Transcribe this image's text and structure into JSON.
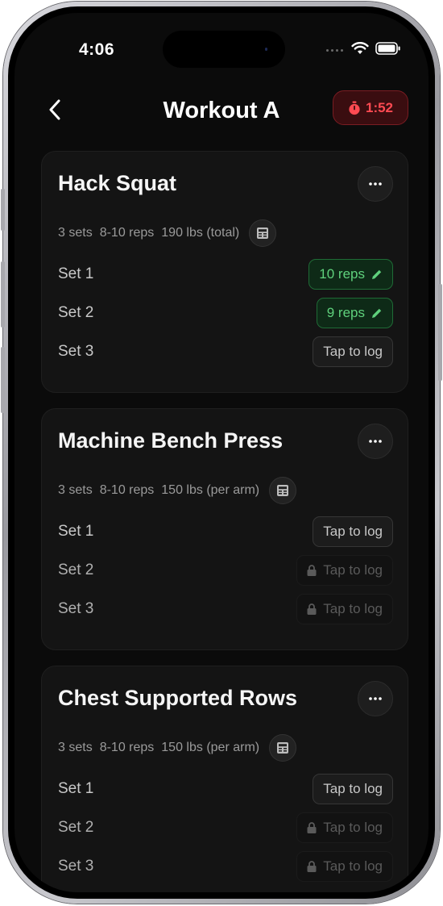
{
  "status": {
    "time": "4:06"
  },
  "header": {
    "title": "Workout A",
    "timer": "1:52"
  },
  "colors": {
    "accent_green": "#5fd17c",
    "timer_red": "#ff4a52",
    "background": "#0b0b0b"
  },
  "exercises": [
    {
      "name": "Hack Squat",
      "sets_text": "3 sets",
      "reps_text": "8-10 reps",
      "weight_text": "190 lbs (total)",
      "sets": [
        {
          "label": "Set 1",
          "status": "done",
          "text": "10 reps"
        },
        {
          "label": "Set 2",
          "status": "done",
          "text": "9 reps"
        },
        {
          "label": "Set 3",
          "status": "tap",
          "text": "Tap to log"
        }
      ]
    },
    {
      "name": "Machine Bench Press",
      "sets_text": "3 sets",
      "reps_text": "8-10 reps",
      "weight_text": "150 lbs (per arm)",
      "sets": [
        {
          "label": "Set 1",
          "status": "tap",
          "text": "Tap to log"
        },
        {
          "label": "Set 2",
          "status": "locked",
          "text": "Tap to log"
        },
        {
          "label": "Set 3",
          "status": "locked",
          "text": "Tap to log"
        }
      ]
    },
    {
      "name": "Chest Supported Rows",
      "sets_text": "3 sets",
      "reps_text": "8-10 reps",
      "weight_text": "150 lbs (per arm)",
      "sets": [
        {
          "label": "Set 1",
          "status": "tap",
          "text": "Tap to log"
        },
        {
          "label": "Set 2",
          "status": "locked",
          "text": "Tap to log"
        },
        {
          "label": "Set 3",
          "status": "locked",
          "text": "Tap to log"
        }
      ]
    }
  ]
}
